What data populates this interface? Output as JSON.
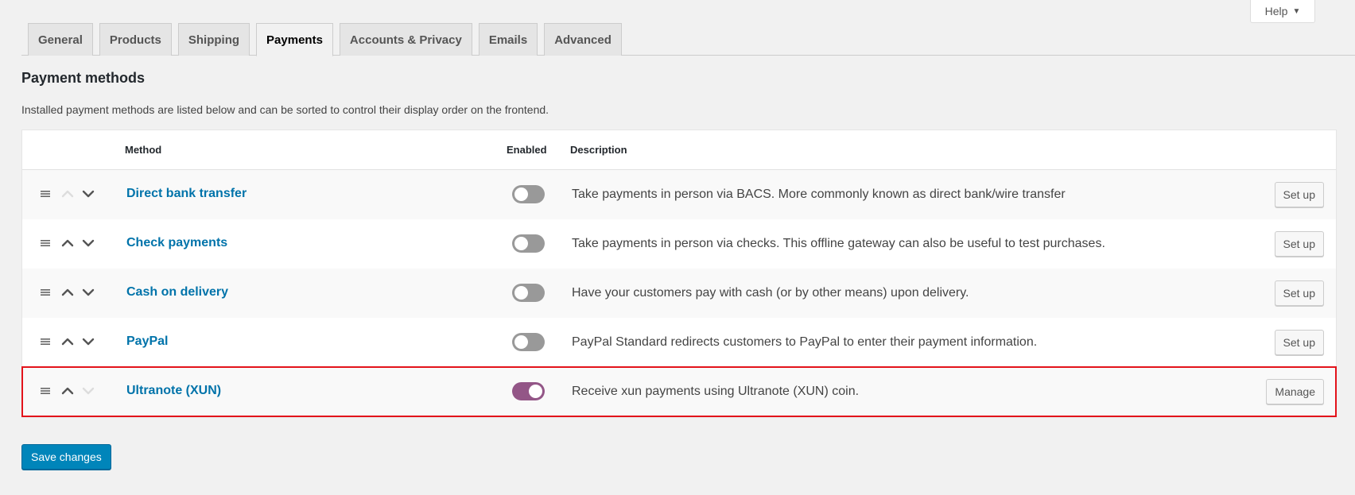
{
  "help": {
    "label": "Help"
  },
  "tabs": [
    {
      "label": "General",
      "active": false
    },
    {
      "label": "Products",
      "active": false
    },
    {
      "label": "Shipping",
      "active": false
    },
    {
      "label": "Payments",
      "active": true
    },
    {
      "label": "Accounts & Privacy",
      "active": false
    },
    {
      "label": "Emails",
      "active": false
    },
    {
      "label": "Advanced",
      "active": false
    }
  ],
  "section": {
    "title": "Payment methods",
    "description": "Installed payment methods are listed below and can be sorted to control their display order on the frontend."
  },
  "table": {
    "headers": {
      "method": "Method",
      "enabled": "Enabled",
      "description": "Description"
    },
    "rows": [
      {
        "name": "Direct bank transfer",
        "enabled": false,
        "description": "Take payments in person via BACS. More commonly known as direct bank/wire transfer",
        "action": "Set up",
        "up_disabled": true,
        "down_disabled": false
      },
      {
        "name": "Check payments",
        "enabled": false,
        "description": "Take payments in person via checks. This offline gateway can also be useful to test purchases.",
        "action": "Set up",
        "up_disabled": false,
        "down_disabled": false
      },
      {
        "name": "Cash on delivery",
        "enabled": false,
        "description": "Have your customers pay with cash (or by other means) upon delivery.",
        "action": "Set up",
        "up_disabled": false,
        "down_disabled": false
      },
      {
        "name": "PayPal",
        "enabled": false,
        "description": "PayPal Standard redirects customers to PayPal to enter their payment information.",
        "action": "Set up",
        "up_disabled": false,
        "down_disabled": false
      },
      {
        "name": "Ultranote (XUN)",
        "enabled": true,
        "description": "Receive xun payments using Ultranote (XUN) coin.",
        "action": "Manage",
        "up_disabled": false,
        "down_disabled": true,
        "highlighted": true
      }
    ]
  },
  "save": {
    "label": "Save changes"
  },
  "colors": {
    "link": "#0073aa",
    "toggle_on": "#935687",
    "toggle_off": "#999999",
    "primary": "#0085ba",
    "highlight": "#e3131b"
  }
}
